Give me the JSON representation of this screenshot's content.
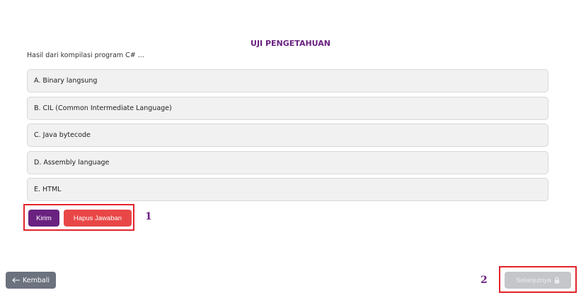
{
  "quiz": {
    "title": "UJI PENGETAHUAN",
    "question": "Hasil dari kompilasi program C# ...",
    "options": [
      {
        "label": "A. Binary langsung"
      },
      {
        "label": "B. CIL (Common Intermediate Language)"
      },
      {
        "label": "C. Java bytecode"
      },
      {
        "label": "D. Assembly language"
      },
      {
        "label": "E. HTML"
      }
    ]
  },
  "actions": {
    "submit_label": "Kirim",
    "clear_label": "Hapus Jawaban"
  },
  "annotations": {
    "marker_1": "1",
    "marker_2": "2",
    "highlight_color": "#e3232b"
  },
  "navigation": {
    "back_label": "Kembali",
    "back_icon": "arrow-left-icon",
    "next_label": "Selanjutnya",
    "next_icon": "lock-icon",
    "next_disabled": true
  },
  "colors": {
    "accent": "#6a2280",
    "danger": "#e94747",
    "back_button": "#6c727e",
    "disabled": "#c4c6ca"
  }
}
